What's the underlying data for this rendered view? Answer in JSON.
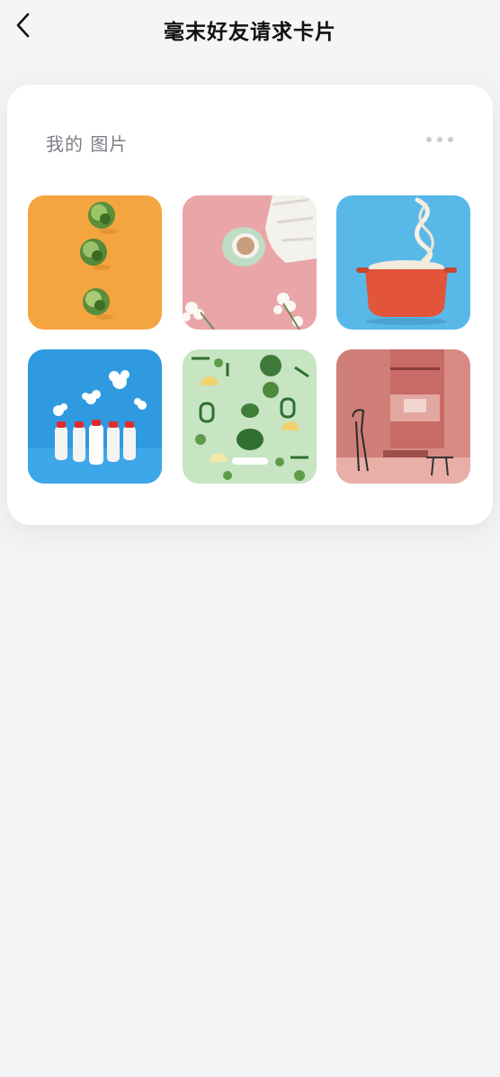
{
  "header": {
    "title": "毫末好友请求卡片"
  },
  "card": {
    "title": "我的 图片"
  },
  "icons": {
    "back": "chevron-left-icon",
    "more": "more-horizontal-icon"
  },
  "colors": {
    "page_bg": "#f2f3f5",
    "card_bg": "#ffffff",
    "muted_text": "#7d7f86",
    "thumb_backgrounds": [
      "#f5a540",
      "#e9a5a8",
      "#58b9e8",
      "#2f9ae0",
      "#c7e4c3",
      "#d98a84"
    ]
  },
  "photos": [
    {
      "subject": "brussels-sprouts-on-orange"
    },
    {
      "subject": "coffee-cup-and-flowers-on-pink"
    },
    {
      "subject": "noodles-pot-on-blue"
    },
    {
      "subject": "milk-bottles-with-clouds"
    },
    {
      "subject": "vegetable-arrangement-on-green"
    },
    {
      "subject": "pink-interior-room"
    }
  ]
}
